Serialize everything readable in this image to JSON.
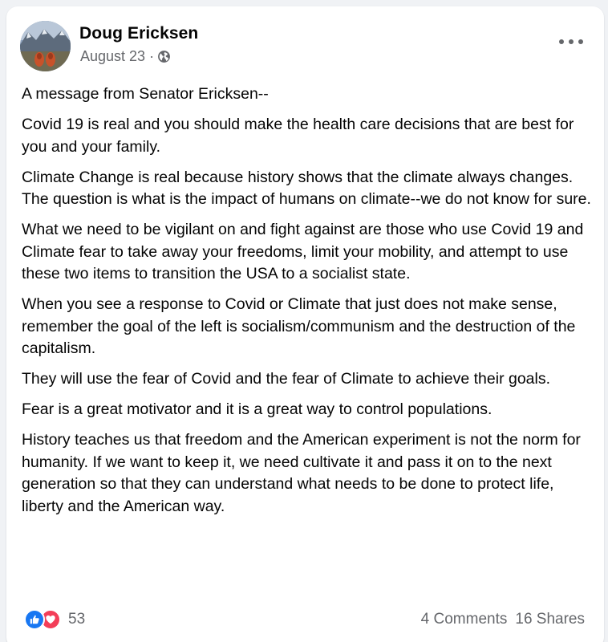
{
  "post": {
    "author": "Doug Ericksen",
    "date": "August 23",
    "separator": "·",
    "privacy_icon": "globe-icon",
    "more_icon": "more-options-icon",
    "paragraphs": [
      "A message from Senator Ericksen--",
      "Covid 19 is real and you should make the health care decisions that are best for you and your family.",
      "Climate Change is real because history shows that the climate always changes.  The question is what is the  impact of humans on climate--we do not know for sure.",
      "What we need to be vigilant on and fight against are those who use Covid 19 and Climate fear to take away your freedoms, limit your mobility, and attempt to use these two items to transition the USA to a socialist state.",
      "When you see a response to Covid or Climate that just does not make sense, remember the goal of the left is socialism/communism and the destruction of the capitalism.",
      "They will use the fear of Covid and the fear of Climate to achieve their goals.",
      "Fear is a great motivator and it is a great way to control populations.",
      "History teaches us that freedom and the American experiment is not the norm for humanity.  If we want to keep it, we need cultivate it and pass it on to the next generation so that they can understand what needs to be done to protect life, liberty and the American way."
    ]
  },
  "footer": {
    "reaction_icons": [
      "like-icon",
      "love-icon"
    ],
    "reaction_count": "53",
    "comments": "4 Comments",
    "shares": "16 Shares"
  },
  "colors": {
    "like": "#1877f2",
    "love": "#f33e58",
    "secondary_text": "#65676b",
    "primary_text": "#050505",
    "background": "#f0f2f5"
  }
}
